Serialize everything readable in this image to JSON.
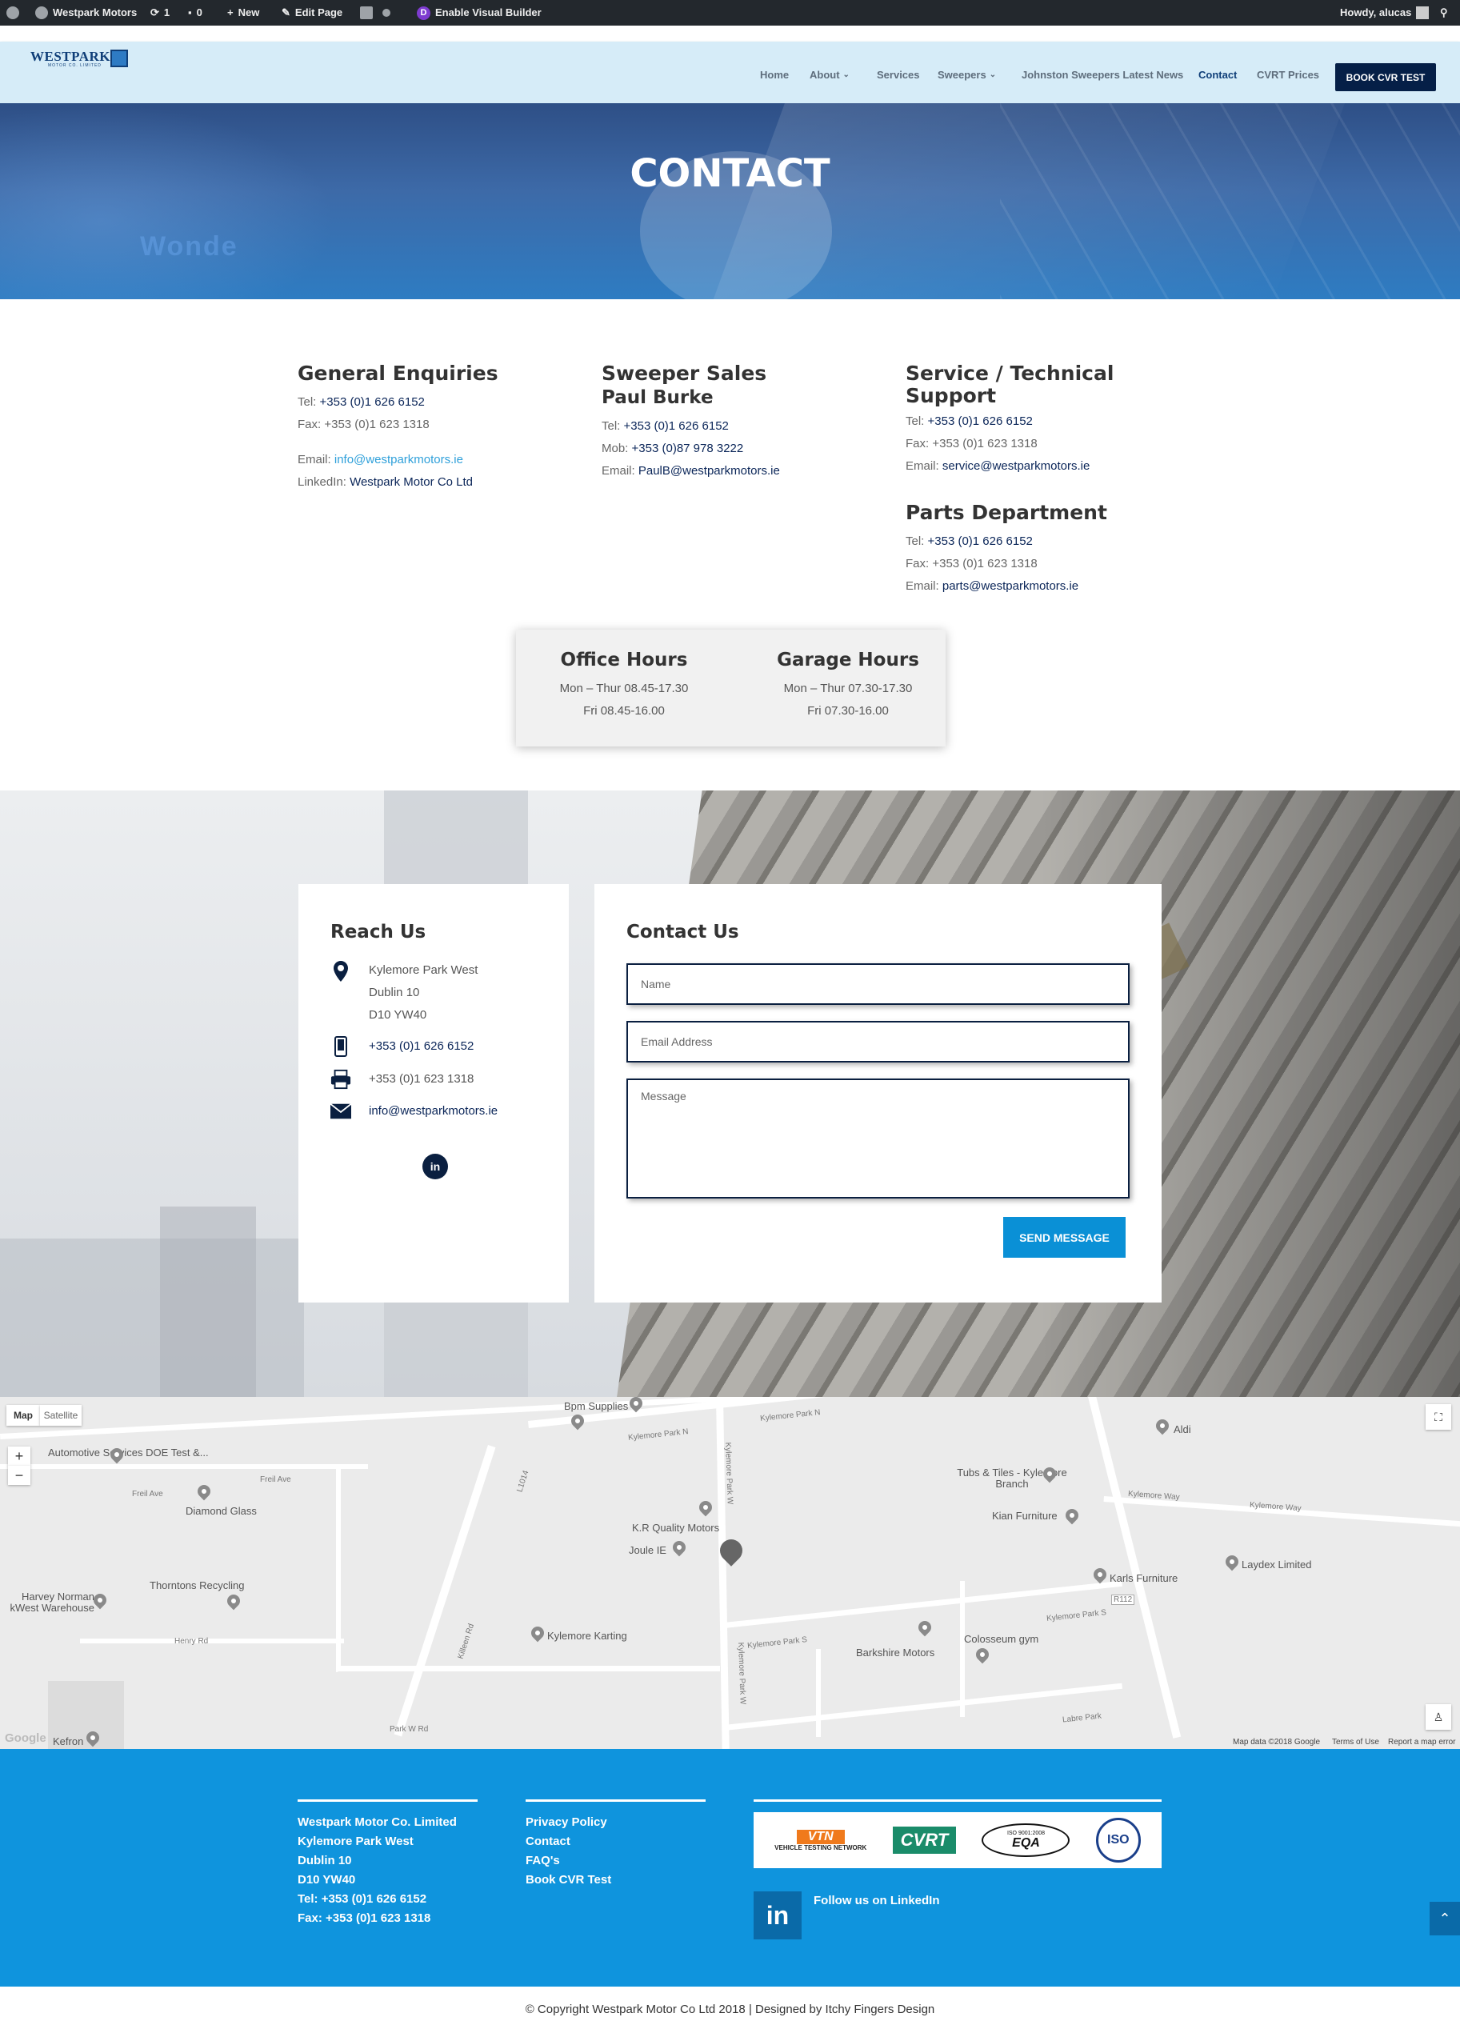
{
  "admin_bar": {
    "site": "Westpark Motors",
    "updates": "1",
    "comments": "0",
    "new": "New",
    "edit": "Edit Page",
    "visual_builder": "Enable Visual Builder",
    "howdy": "Howdy, alucas"
  },
  "header": {
    "logo_text": "WESTPARK",
    "logo_sub": "MOTOR CO. LIMITED",
    "nav": [
      {
        "label": "Home"
      },
      {
        "label": "About"
      },
      {
        "label": "Services"
      },
      {
        "label": "Sweepers"
      },
      {
        "label": "Johnston Sweepers Latest News"
      },
      {
        "label": "Contact"
      },
      {
        "label": "CVRT Prices"
      }
    ],
    "book_button": "BOOK CVR TEST"
  },
  "hero": {
    "title": "CONTACT",
    "bg_text": "Wonde"
  },
  "general": {
    "title": "General Enquiries",
    "tel_label": "Tel:",
    "tel": "+353 (0)1 626 6152",
    "fax": "Fax: +353 (0)1 623 1318",
    "email_label": "Email:",
    "email": "info@westparkmotors.ie",
    "linkedin_label": "LinkedIn:",
    "linkedin": "Westpark Motor Co Ltd"
  },
  "sweeper": {
    "title": "Sweeper Sales",
    "name": "Paul Burke",
    "tel_label": "Tel:",
    "tel": "+353 (0)1 626 6152",
    "mob_label": "Mob:",
    "mob": "+353 (0)87 978 3222",
    "email_label": "Email:",
    "email": "PaulB@westparkmotors.ie"
  },
  "service": {
    "title": "Service / Technical Support",
    "tel_label": "Tel:",
    "tel": "+353 (0)1 626 6152",
    "fax": "Fax: +353 (0)1 623 1318",
    "email_label": "Email:",
    "email": "service@westparkmotors.ie"
  },
  "parts": {
    "title": "Parts Department",
    "tel_label": "Tel:",
    "tel": "+353 (0)1 626 6152",
    "fax": "Fax: +353 (0)1 623 1318",
    "email_label": "Email:",
    "email": "parts@westparkmotors.ie"
  },
  "hours": {
    "office_title": "Office Hours",
    "office_1": "Mon – Thur  08.45-17.30",
    "office_2": "Fri  08.45-16.00",
    "garage_title": "Garage Hours",
    "garage_1": "Mon – Thur  07.30-17.30",
    "garage_2": "Fri  07.30-16.00"
  },
  "reach": {
    "title": "Reach Us",
    "addr1": "Kylemore Park West",
    "addr2": "Dublin 10",
    "addr3": "D10 YW40",
    "phone": "+353 (0)1 626 6152",
    "fax": "+353 (0)1 623 1318",
    "email": "info@westparkmotors.ie",
    "linkedin_glyph": "in"
  },
  "contact_form": {
    "title": "Contact Us",
    "name_ph": "Name",
    "email_ph": "Email Address",
    "message_ph": "Message",
    "send": "SEND MESSAGE"
  },
  "map": {
    "map_tab": "Map",
    "satellite_tab": "Satellite",
    "zoom_in": "+",
    "zoom_out": "−",
    "places": [
      "Bpm Supplies",
      "Kylemore Park N",
      "Aldi",
      "Automotive Services DOE Test &...",
      "Freil Ave",
      "Diamond Glass",
      "Tubs & Tiles - Kylemore Branch",
      "Kian Furniture",
      "K.R Quality Motors",
      "Joule IE",
      "Thorntons Recycling",
      "Harvey Norman kWest Warehouse",
      "Karls Furniture",
      "Laydex Limited",
      "Kylemore Karting",
      "Barkshire Motors",
      "Colosseum gym",
      "Kefron",
      "Kylemore Way",
      "Kylemore Park W",
      "Killeen Rd",
      "Henry Rd",
      "Park W Rd",
      "Labre Park",
      "Kylemore Park S",
      "L1014",
      "R112"
    ],
    "attribution": "Map data ©2018 Google",
    "terms": "Terms of Use",
    "report": "Report a map error",
    "google": "Google"
  },
  "footer": {
    "company": [
      "Westpark Motor Co. Limited",
      "Kylemore Park West",
      "Dublin 10",
      "D10 YW40",
      "Tel: +353 (0)1 626 6152",
      "Fax: +353 (0)1 623 1318"
    ],
    "links": [
      "Privacy Policy",
      "Contact",
      "FAQ's",
      "Book CVR Test"
    ],
    "logos": [
      "VTN",
      "CVRT",
      "EQA",
      "ISO"
    ],
    "vtn_sub": "VEHICLE TESTING NETWORK",
    "eqa_sub": "ISO 9001:2008",
    "linkedin_glyph": "in",
    "follow": "Follow us on LinkedIn",
    "copyright": "© Copyright Westpark Motor Co Ltd 2018 | Designed by Itchy Fingers Design"
  }
}
